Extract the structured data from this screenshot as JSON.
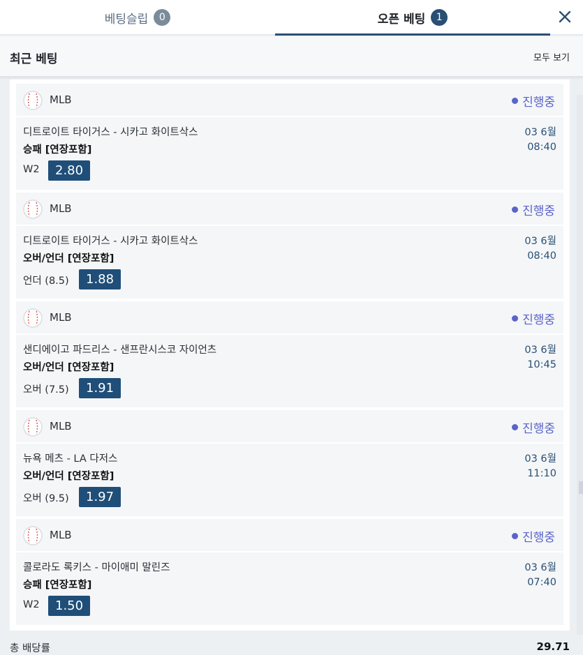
{
  "tabs": {
    "slip_label": "베팅슬립",
    "slip_count": "0",
    "open_label": "오픈 베팅",
    "open_count": "1"
  },
  "section": {
    "title": "최근 베팅",
    "view_all": "모두 보기"
  },
  "bets": [
    {
      "league": "MLB",
      "status": "진행중",
      "match": "디트로이트 타이거스 - 시카고 화이트삭스",
      "market": "승패 [연장포함]",
      "pick": "W2",
      "odds": "2.80",
      "date": "03 6월",
      "time": "08:40"
    },
    {
      "league": "MLB",
      "status": "진행중",
      "match": "디트로이트 타이거스 - 시카고 화이트삭스",
      "market": "오버/언더 [연장포함]",
      "pick": "언더 (8.5)",
      "odds": "1.88",
      "date": "03 6월",
      "time": "08:40"
    },
    {
      "league": "MLB",
      "status": "진행중",
      "match": "샌디에이고 파드리스 - 샌프란시스코 자이언츠",
      "market": "오버/언더 [연장포함]",
      "pick": "오버 (7.5)",
      "odds": "1.91",
      "date": "03 6월",
      "time": "10:45"
    },
    {
      "league": "MLB",
      "status": "진행중",
      "match": "뉴욕 메츠 - LA 다저스",
      "market": "오버/언더 [연장포함]",
      "pick": "오버 (9.5)",
      "odds": "1.97",
      "date": "03 6월",
      "time": "11:10"
    },
    {
      "league": "MLB",
      "status": "진행중",
      "match": "콜로라도 록키스 - 마이애미 말린즈",
      "market": "승패 [연장포함]",
      "pick": "W2",
      "odds": "1.50",
      "date": "03 6월",
      "time": "07:40"
    }
  ],
  "footer": {
    "total_label": "총 배당률",
    "total_value": "29.71"
  },
  "icons": {
    "close": "close-icon",
    "league": "baseball-icon"
  },
  "colors": {
    "accent": "#2a4f73",
    "odds_bg": "#1f4e78",
    "status": "#5b63c9"
  }
}
